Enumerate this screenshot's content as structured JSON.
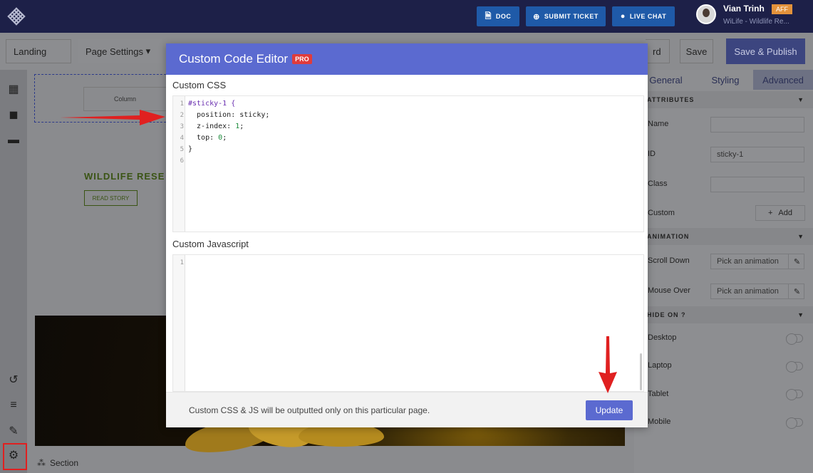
{
  "topbar": {
    "doc_label": "DOC",
    "ticket_label": "SUBMIT TICKET",
    "chat_label": "LIVE CHAT",
    "user_name": "Vian Trinh",
    "user_badge": "AFF",
    "user_sub": "WiLife - Wildlife Re..."
  },
  "toolbar": {
    "page_label": "Landing",
    "page_settings": "Page Settings",
    "partial_label": "rd",
    "save_label": "Save",
    "publish_label": "Save & Publish"
  },
  "canvas": {
    "column_label": "Column",
    "heading": "WILDLIFE RESE",
    "read_story": "READ STORY",
    "section_label": "Section"
  },
  "panel": {
    "tabs": [
      "General",
      "Styling",
      "Advanced"
    ],
    "attributes_head": "ATTRIBUTES",
    "name_label": "Name",
    "name_value": "",
    "id_label": "ID",
    "id_value": "sticky-1",
    "class_label": "Class",
    "class_value": "",
    "custom_label": "Custom",
    "add_label": "Add",
    "animation_head": "ANIMATION",
    "scroll_label": "Scroll Down",
    "mouse_label": "Mouse Over",
    "animation_placeholder": "Pick an animation",
    "hide_head": "HIDE ON",
    "devices": [
      "Desktop",
      "Laptop",
      "Tablet",
      "Mobile"
    ]
  },
  "modal": {
    "title": "Custom Code Editor",
    "pro": "PRO",
    "css_label": "Custom CSS",
    "css_lines": [
      "#sticky-1 {",
      "  position: sticky;",
      "  z-index: 1;",
      "  top: 0;",
      "}",
      ""
    ],
    "js_label": "Custom Javascript",
    "js_lines": [
      ""
    ],
    "footer_text": "Custom CSS & JS will be outputted only on this particular page.",
    "update_label": "Update"
  },
  "colors": {
    "modal_accent": "#5b6ad0",
    "annotation_red": "#e02020",
    "topbar": "#1d2048"
  }
}
